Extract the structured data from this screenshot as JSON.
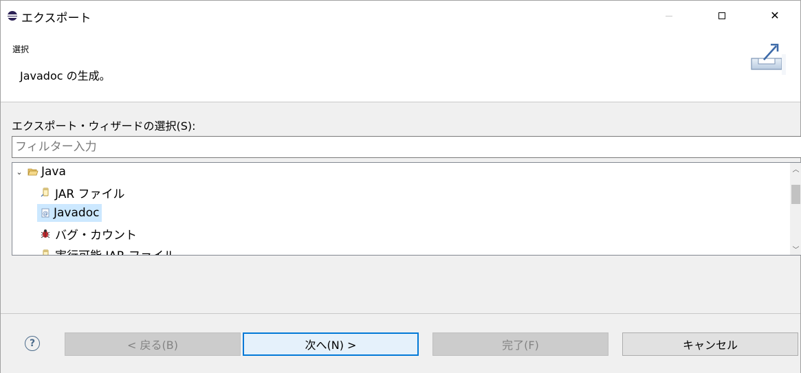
{
  "window": {
    "title": "エクスポート"
  },
  "header": {
    "title": "選択",
    "description": "Javadoc の生成。"
  },
  "wizard": {
    "label": "エクスポート・ウィザードの選択(S):",
    "filter_placeholder": "フィルター入力",
    "tree": [
      {
        "label": "Java",
        "expanded": true,
        "icon": "folder-open-icon"
      },
      {
        "label": "JAR ファイル",
        "icon": "jar-icon"
      },
      {
        "label": "Javadoc",
        "icon": "javadoc-icon",
        "selected": true
      },
      {
        "label": "バグ・カウント",
        "icon": "bug-icon"
      },
      {
        "label": "実行可能 JAR ファイル",
        "icon": "jar-icon"
      }
    ]
  },
  "buttons": {
    "help": "?",
    "back": "< 戻る(B)",
    "next": "次へ(N) >",
    "finish": "完了(F)",
    "cancel": "キャンセル"
  },
  "colors": {
    "accent": "#0078d7",
    "selection": "#cce8ff"
  }
}
